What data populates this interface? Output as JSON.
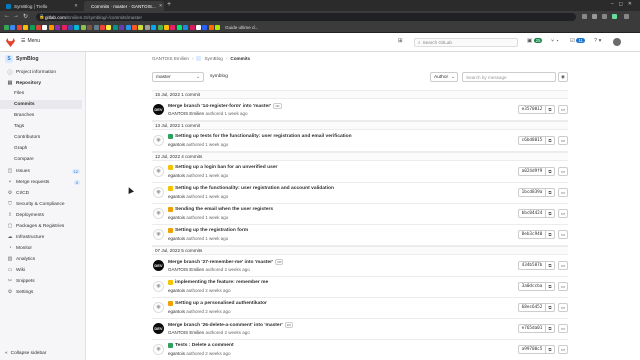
{
  "browser": {
    "tabs": [
      {
        "title": "SymBlog | Trello",
        "favicon_color": "#0079bf"
      },
      {
        "title": "Commits · master · GANTOIS...",
        "favicon_color": "#e24329"
      }
    ],
    "url_host": "gitlab.com",
    "url_path": "/Emilien.G/symblog/-/commits/master",
    "bookmarks_text": "Guide ultime d...",
    "bookmark_colors": [
      "#34a853",
      "#4285f4",
      "#ea4335",
      "#fbbc05",
      "#0f9d58",
      "#db4437",
      "#ffffff",
      "#ff9800",
      "#9c27b0",
      "#e91e63",
      "#3f51b5",
      "#00bcd4",
      "#8bc34a",
      "#795548",
      "#607d8b",
      "#f44336",
      "#ffeb3b",
      "#009688",
      "#673ab7",
      "#2196f3",
      "#ff5722",
      "#cddc39",
      "#9e9e9e",
      "#03a9f4",
      "#4caf50",
      "#ffc107",
      "#e91e63",
      "#00e676",
      "#1e88e5",
      "#d81b60",
      "#ffffff",
      "#2962ff",
      "#ff6d00",
      "#aeea00"
    ]
  },
  "topbar": {
    "menu_label": "Menu",
    "search_placeholder": "Search GitLab",
    "merge_count": "25",
    "issues_count": "11"
  },
  "sidebar": {
    "project_initial": "S",
    "project_name": "SymBlog",
    "items": [
      {
        "label": "Project information",
        "icon": "info-icon"
      },
      {
        "label": "Repository",
        "icon": "repository-icon"
      },
      {
        "label": "Issues",
        "icon": "issues-icon",
        "count": "12"
      },
      {
        "label": "Merge requests",
        "icon": "merge-request-icon",
        "count": "0"
      },
      {
        "label": "CI/CD",
        "icon": "rocket-icon"
      },
      {
        "label": "Security & Compliance",
        "icon": "shield-icon"
      },
      {
        "label": "Deployments",
        "icon": "deployments-icon"
      },
      {
        "label": "Packages & Registries",
        "icon": "package-icon"
      },
      {
        "label": "Infrastructure",
        "icon": "cloud-icon"
      },
      {
        "label": "Monitor",
        "icon": "monitor-icon"
      },
      {
        "label": "Analytics",
        "icon": "chart-icon"
      },
      {
        "label": "Wiki",
        "icon": "book-icon"
      },
      {
        "label": "Snippets",
        "icon": "snippet-icon"
      },
      {
        "label": "Settings",
        "icon": "gear-icon"
      }
    ],
    "repo_sub": [
      "Files",
      "Branches",
      "Tags",
      "Contributors",
      "Graph",
      "Compare"
    ],
    "active_sub": "Commits",
    "collapse_label": "Collapse sidebar"
  },
  "breadcrumb": {
    "owner": "GANTOIS Emilien",
    "project": "SymBlog",
    "current": "Commits"
  },
  "controls": {
    "branch": "master",
    "path": "symblog",
    "author_label": "Author",
    "search_placeholder": "Search by message"
  },
  "groups": [
    {
      "date": "15 Jul, 2022 1 commit",
      "commits": [
        {
          "title": "Merge branch '14-register-form' into 'master'",
          "avatar": "DEV",
          "author": "GANTOIS Emilien",
          "time": "authored 1 week ago",
          "sha": "e3570012",
          "emoji_color": "",
          "has_ellipsis": true
        }
      ]
    },
    {
      "date": "13 Jul, 2022 1 commit",
      "commits": [
        {
          "title": "Setting up tests for the functionality: user registration and email verification",
          "avatar": "ID",
          "author": "egantois",
          "time": "authored 1 week ago",
          "sha": "c6bd8815",
          "emoji_color": "#2da160",
          "has_ellipsis": false
        }
      ]
    },
    {
      "date": "12 Jul, 2022 4 commits",
      "commits": [
        {
          "title": "Setting up a login ban for an unverified user",
          "avatar": "ID",
          "author": "egantois",
          "time": "authored 1 week ago",
          "sha": "a024d9f9",
          "emoji_color": "#f5c400",
          "has_ellipsis": false
        },
        {
          "title": "Setting up the functionality: user registration and account validation",
          "avatar": "ID",
          "author": "egantois",
          "time": "authored 1 week ago",
          "sha": "1bcd839a",
          "emoji_color": "#f5c400",
          "has_ellipsis": false
        },
        {
          "title": "Sending the email when the user registers",
          "avatar": "ID",
          "author": "egantois",
          "time": "authored 1 week ago",
          "sha": "bbc04424",
          "emoji_color": "#f0a000",
          "has_ellipsis": false
        },
        {
          "title": "Setting up the registration form",
          "avatar": "ID",
          "author": "egantois",
          "time": "authored 1 week ago",
          "sha": "8eb3c940",
          "emoji_color": "#f0a000",
          "has_ellipsis": false
        }
      ]
    },
    {
      "date": "07 Jul, 2022 5 commits",
      "commits": [
        {
          "title": "Merge branch '27-remember-me' into 'master'",
          "avatar": "DEV",
          "author": "GANTOIS Emilien",
          "time": "authored 2 weeks ago",
          "sha": "434b587b",
          "emoji_color": "",
          "has_ellipsis": true
        },
        {
          "title": "implementing the feature: remember me",
          "avatar": "ID",
          "author": "egantois",
          "time": "authored 2 weeks ago",
          "sha": "3a0dccba",
          "emoji_color": "#f5c400",
          "has_ellipsis": false
        },
        {
          "title": "Setting up a personalised authentikator",
          "avatar": "ID",
          "author": "egantois",
          "time": "authored 2 weeks ago",
          "sha": "68ec6452",
          "emoji_color": "#f0a000",
          "has_ellipsis": false
        },
        {
          "title": "Merge branch '26-delete-a-comment' into 'master'",
          "avatar": "DEV",
          "author": "GANTOIS Emilien",
          "time": "authored 2 weeks ago",
          "sha": "e765da01",
          "emoji_color": "",
          "has_ellipsis": true
        },
        {
          "title": "Tests : Delete a comment",
          "avatar": "ID",
          "author": "egantois",
          "time": "authored 2 weeks ago",
          "sha": "a99700c5",
          "emoji_color": "#2da160",
          "has_ellipsis": false
        }
      ]
    }
  ]
}
